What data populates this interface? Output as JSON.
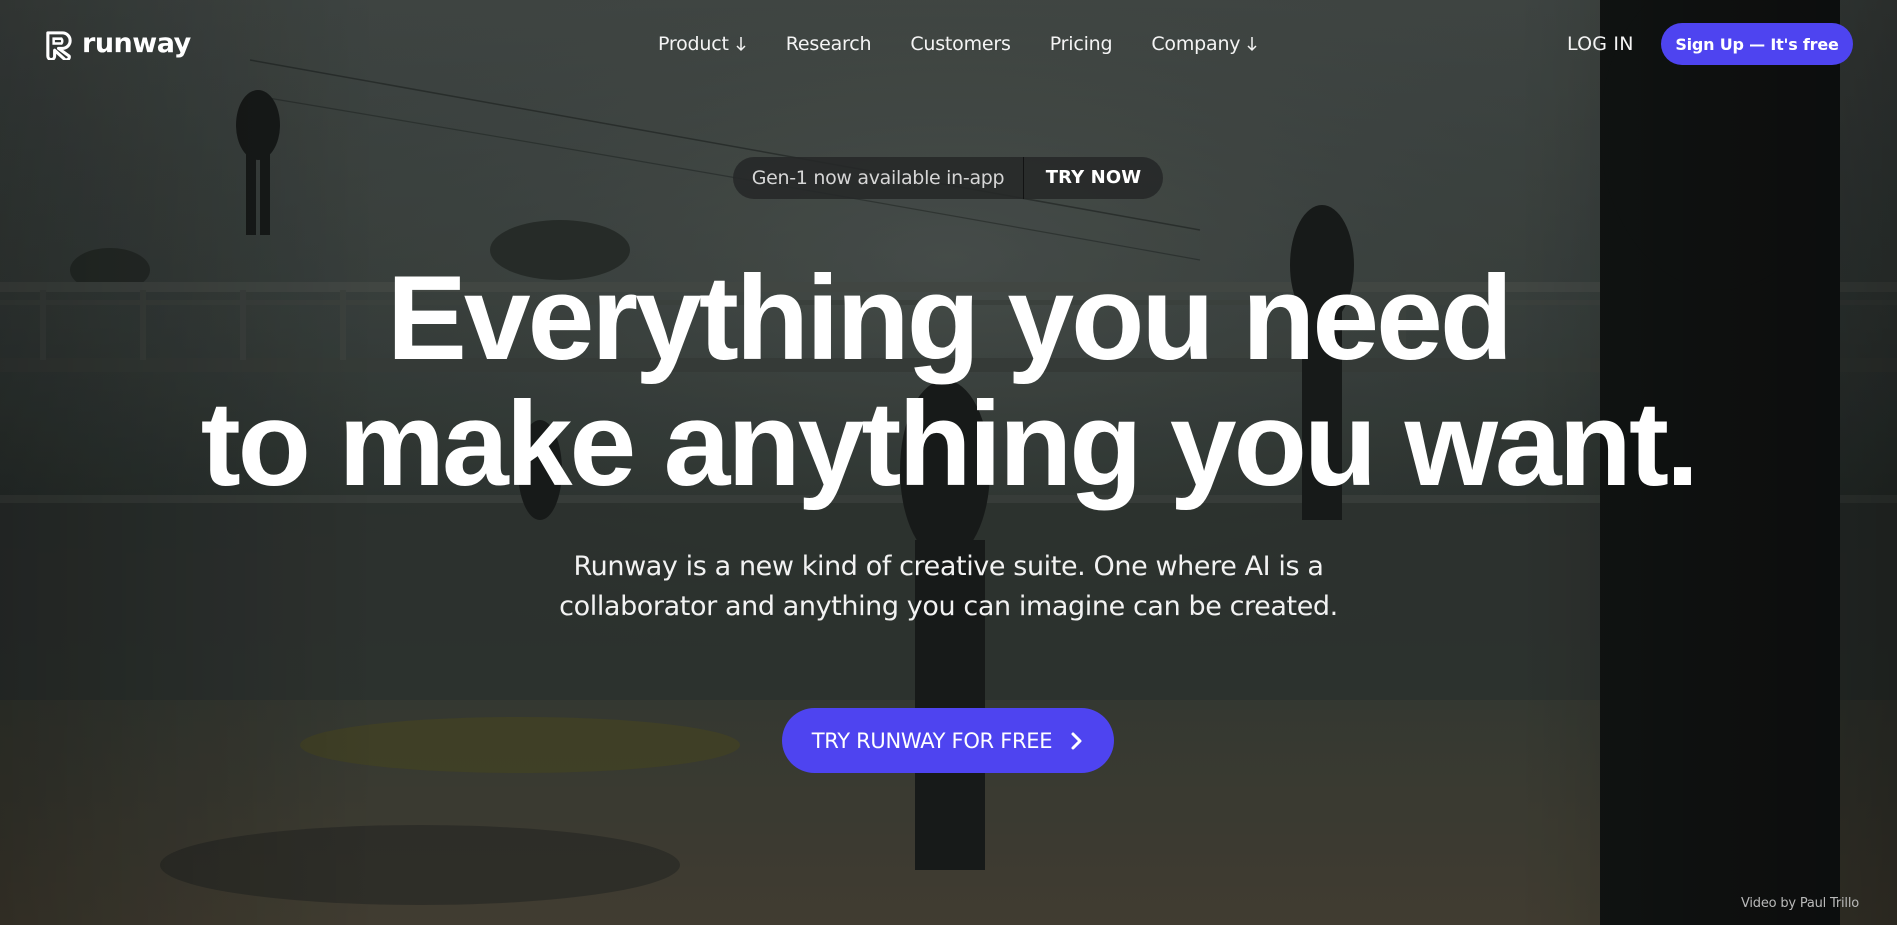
{
  "brand": {
    "name": "runway",
    "logo_icon": "runway-logo-icon"
  },
  "nav": {
    "items": [
      {
        "label": "Product",
        "has_dropdown": true
      },
      {
        "label": "Research",
        "has_dropdown": false
      },
      {
        "label": "Customers",
        "has_dropdown": false
      },
      {
        "label": "Pricing",
        "has_dropdown": false
      },
      {
        "label": "Company",
        "has_dropdown": true
      }
    ],
    "dropdown_icon": "arrow-down-icon"
  },
  "auth": {
    "login_label": "LOG IN",
    "signup_label": "Sign Up — It's free"
  },
  "announcement": {
    "text": "Gen-1 now available in-app",
    "cta_label": "TRY NOW"
  },
  "hero": {
    "headline_line1": "Everything you need",
    "headline_line2": "to make anything you want.",
    "subhead_line1": "Runway is a new kind of creative suite. One where AI is a",
    "subhead_line2": "collaborator and anything you can imagine can be created.",
    "cta_label": "TRY RUNWAY FOR FREE",
    "cta_icon": "chevron-right-icon"
  },
  "video_credit": "Video by Paul Trillo",
  "colors": {
    "accent": "#4e44f0",
    "text": "#ffffff",
    "pill_bg": "#262828"
  }
}
